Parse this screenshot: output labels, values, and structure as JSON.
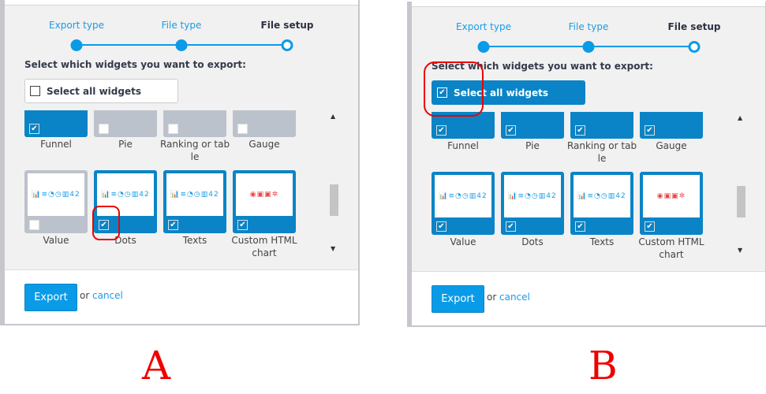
{
  "steps": [
    "Export type",
    "File type",
    "File setup"
  ],
  "heading": "Select which widgets you want to export:",
  "select_all_label": "Select all widgets",
  "top_row": [
    "Funnel",
    "Pie",
    "Ranking or tab\nle",
    "Gauge"
  ],
  "bottom_row": [
    "Value",
    "Dots",
    "Texts",
    "Custom HTML\nchart"
  ],
  "thumb_icons": "📊≡◔◷▥42",
  "export_label": "Export",
  "or_label": "or",
  "cancel_label": "cancel",
  "panels": [
    {
      "caption": "A",
      "select_all_checked": false,
      "top_checked": [
        true,
        false,
        false,
        false
      ],
      "bottom_checked": [
        false,
        true,
        true,
        true
      ]
    },
    {
      "caption": "B",
      "select_all_checked": true,
      "top_checked": [
        true,
        true,
        true,
        true
      ],
      "bottom_checked": [
        true,
        true,
        true,
        true
      ]
    }
  ],
  "colors": {
    "accent": "#0a9be8",
    "selected": "#0a84c6",
    "highlight": "#e00000"
  }
}
